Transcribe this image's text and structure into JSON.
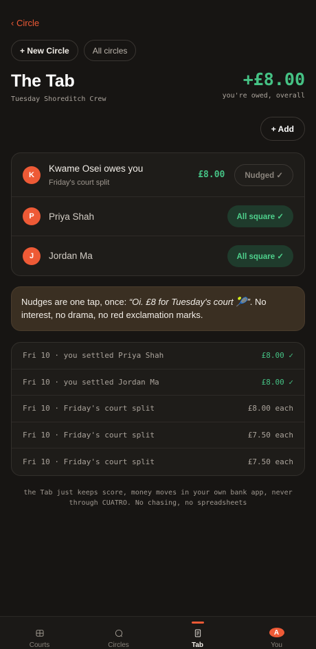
{
  "nav": {
    "back_label": "‹ Circle"
  },
  "actions": {
    "new_circle": "+ New Circle",
    "all_circles": "All circles",
    "add": "+ Add"
  },
  "header": {
    "title": "The Tab",
    "subtitle": "Tuesday Shoreditch Crew",
    "total": "+£8.00",
    "total_caption": "you're owed, overall"
  },
  "members": [
    {
      "initial": "K",
      "name": "Kwame Osei owes you",
      "note": "Friday's court split",
      "amount": "£8.00",
      "status": "Nudged ✓"
    },
    {
      "initial": "P",
      "name": "Priya Shah",
      "status": "All square ✓"
    },
    {
      "initial": "J",
      "name": "Jordan Ma",
      "status": "All square ✓"
    }
  ],
  "notice": {
    "prefix": "Nudges are one tap, once: ",
    "quote": "“Oi. £8 for Tuesday's court 🎾”",
    "suffix": ". No interest, no drama, no red exclamation marks."
  },
  "ledger": [
    {
      "desc": "Fri 10 · you settled Priya Shah",
      "amount": "£8.00 ✓"
    },
    {
      "desc": "Fri 10 · you settled Jordan Ma",
      "amount": "£8.00 ✓"
    },
    {
      "desc": "Fri 10 · Friday's court split",
      "amount": "£8.00 each"
    },
    {
      "desc": "Fri 10 · Friday's court split",
      "amount": "£7.50 each"
    },
    {
      "desc": "Fri 10 · Friday's court split",
      "amount": "£7.50 each"
    }
  ],
  "footer_note": "the Tab just keeps score, money moves in your own bank app, never through CUATRO. No chasing, no spreadsheets",
  "tabbar": [
    {
      "label": "Courts",
      "icon": "grid-icon"
    },
    {
      "label": "Circles",
      "icon": "circle-icon"
    },
    {
      "label": "Tab",
      "icon": "receipt-icon",
      "active": true
    },
    {
      "label": "You",
      "icon": "avatar",
      "initial": "A"
    }
  ],
  "colors": {
    "accent": "#ee5a36",
    "positive": "#45c184",
    "background": "#171513"
  }
}
